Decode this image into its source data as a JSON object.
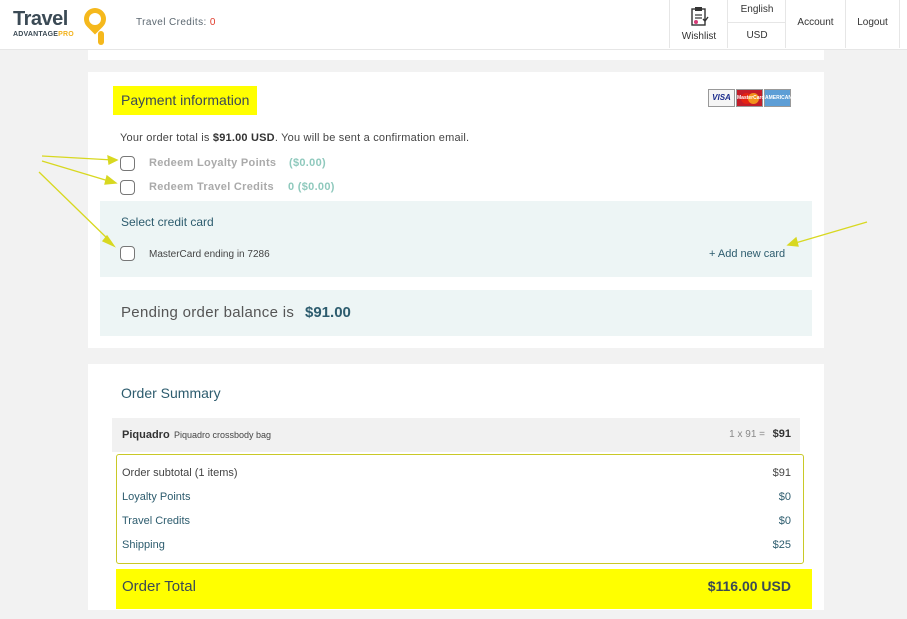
{
  "header": {
    "logo_text": "Travel",
    "logo_sub": "ADVANTAGE",
    "logo_pro": "PRO",
    "credits_label": "Travel Credits:",
    "credits_value": "0",
    "nav": {
      "wishlist": "Wishlist",
      "language": "English",
      "currency": "USD",
      "account": "Account",
      "logout": "Logout"
    }
  },
  "payment": {
    "title": "Payment information",
    "order_total_prefix": "Your order total is",
    "order_total_amount": "$91.00 USD",
    "order_total_suffix": ". You will be sent a confirmation email.",
    "redeem_loyalty_label": "Redeem Loyalty Points",
    "redeem_loyalty_amount": "($0.00)",
    "redeem_credits_label": "Redeem Travel Credits",
    "redeem_credits_amount": "0 ($0.00)",
    "card_logos": [
      "VISA",
      "MasterCard",
      "AMERICAN EXPRESS"
    ],
    "select_card_title": "Select credit card",
    "saved_card_label": "MasterCard ending in 7286",
    "add_card_link": "+ Add new card",
    "pending_label": "Pending order balance is",
    "pending_amount": "$91.00"
  },
  "summary": {
    "title": "Order Summary",
    "item": {
      "brand": "Piquadro",
      "name": "Piquadro crossbody bag",
      "qty": "1 x 91 =",
      "price": "$91"
    },
    "rows": [
      {
        "label": "Order subtotal (1 items)",
        "value": "$91"
      },
      {
        "label": "Loyalty Points",
        "value": "$0"
      },
      {
        "label": "Travel Credits",
        "value": "$0"
      },
      {
        "label": "Shipping",
        "value": "$25"
      }
    ],
    "total_label": "Order Total",
    "total_value": "$116.00 USD"
  },
  "colors": {
    "highlight": "#ffff00",
    "teal_text": "#2d5c6e",
    "panel_bg": "#edf5f5",
    "credits_red": "#e03b2b",
    "arrow": "#d8d820"
  }
}
